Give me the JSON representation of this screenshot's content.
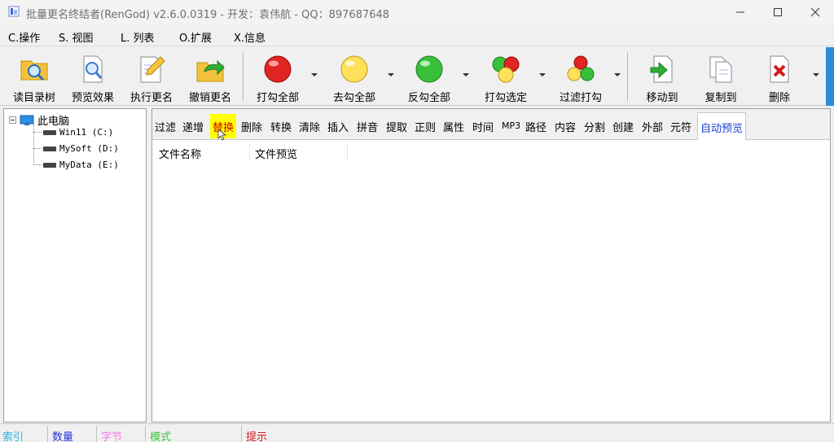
{
  "window": {
    "title": "批量更名终结者(RenGod) v2.6.0.0319 - 开发：袁伟航 - QQ：897687648"
  },
  "menu": [
    {
      "label": "C.操作"
    },
    {
      "label": "S. 视图"
    },
    {
      "label": "L. 列表"
    },
    {
      "label": "O.扩展"
    },
    {
      "label": "X.信息"
    }
  ],
  "toolbar": {
    "read_dir": "读目录树",
    "preview": "预览效果",
    "execute": "执行更名",
    "undo": "撤销更名",
    "check_all": "打勾全部",
    "uncheck_all": "去勾全部",
    "invert_all": "反勾全部",
    "check_selected": "打勾选定",
    "filter_check": "过滤打勾",
    "move_to": "移动到",
    "copy_to": "复制到",
    "delete": "删除"
  },
  "tree": {
    "root": "此电脑",
    "drives": [
      {
        "label": "Win11 (C:)"
      },
      {
        "label": "MySoft (D:)"
      },
      {
        "label": "MyData (E:)"
      }
    ]
  },
  "tabs": [
    {
      "label": "过滤"
    },
    {
      "label": "递增"
    },
    {
      "label": "替换"
    },
    {
      "label": "删除"
    },
    {
      "label": "转换"
    },
    {
      "label": "清除"
    },
    {
      "label": "插入"
    },
    {
      "label": "拼音"
    },
    {
      "label": "提取"
    },
    {
      "label": "正则"
    },
    {
      "label": "属性"
    },
    {
      "label": "时间"
    },
    {
      "label": "MP3"
    },
    {
      "label": "路径"
    },
    {
      "label": "内容"
    },
    {
      "label": "分割"
    },
    {
      "label": "创建"
    },
    {
      "label": "外部"
    },
    {
      "label": "元符"
    },
    {
      "label": "自动预览"
    }
  ],
  "file_list": {
    "columns": [
      "文件名称",
      "文件预览"
    ]
  },
  "status": {
    "index": "索引",
    "count": "数量",
    "bytes": "字节",
    "mode": "模式",
    "hint": "提示"
  },
  "colors": {
    "index": "#23b8e6",
    "count": "#2236d6",
    "bytes": "#f27be0",
    "mode": "#3cc23c",
    "hint": "#d21414",
    "active_tab_bg": "#ffff00",
    "active_tab_text": "#d10000",
    "auto_preview_text": "#1a3fd6"
  }
}
